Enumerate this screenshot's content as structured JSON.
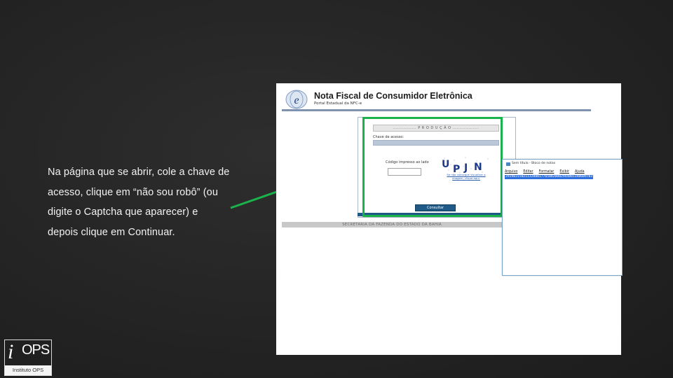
{
  "instruction": {
    "text": "Na página que se abrir, cole a chave de acesso, clique em “não sou robô” (ou digite o Captcha que aparecer) e depois clique em Continuar."
  },
  "portal": {
    "title": "Nota Fiscal de Consumidor Eletrônica",
    "subtitle": "Portal Estadual da NFC-e",
    "environment": "................ P R O D U Ç Ã O ..................",
    "access_key_label": "Chave de acesso:",
    "access_key_value": "",
    "captcha_label": "Código impresso ao lado",
    "captcha_value": "",
    "captcha_link": "Se não consegue visualizar a imagem, clique aqui.",
    "submit_label": "Consultar",
    "footer": "SECRETARIA DA FAZENDA DO ESTADO DA BAHIA"
  },
  "notepad": {
    "title": "Sem título - Bloco de notas",
    "menu": [
      "Arquivo",
      "Editar",
      "Formatar",
      "Exibir",
      "Ajuda"
    ],
    "selected_text": "29190315021132000177650020002944881348609783"
  },
  "logo": {
    "word": "OPS",
    "caption": "Instituto OPS"
  },
  "colors": {
    "highlight": "#1ab24a",
    "portal_blue": "#1f5a86",
    "background": "#242424",
    "selection": "#2f6fdb"
  }
}
